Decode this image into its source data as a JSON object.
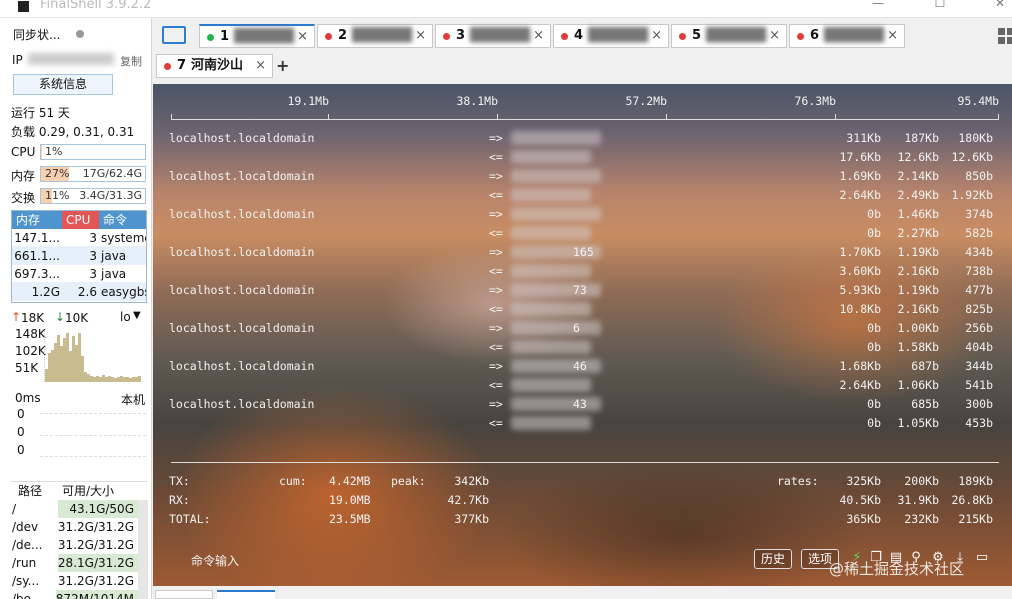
{
  "window": {
    "title": "FinalShell 3.9.2.2",
    "minimize_icon": "—",
    "maximize_icon": "☐",
    "close_icon": "✕"
  },
  "sidebar": {
    "sync_status": "同步状...",
    "ip_label": "IP",
    "copy_label": "复制",
    "sysinfo_button": "系统信息",
    "uptime": "运行 51 天",
    "load": "负载 0.29, 0.31, 0.31",
    "cpu": {
      "label": "CPU",
      "value": "1%",
      "percent": 1
    },
    "mem": {
      "label": "内存",
      "percent_text": "27%",
      "detail": "17G/62.4G",
      "percent": 27
    },
    "swap": {
      "label": "交换",
      "percent_text": "11%",
      "detail": "3.4G/31.3G",
      "percent": 11
    },
    "proc_headers": [
      "内存",
      "CPU",
      "命令"
    ],
    "processes": [
      {
        "mem": "147.1...",
        "cpu": "3",
        "cmd": "systemd"
      },
      {
        "mem": "661.1...",
        "cpu": "3",
        "cmd": "java"
      },
      {
        "mem": "697.3...",
        "cpu": "3",
        "cmd": "java"
      },
      {
        "mem": "1.2G",
        "cpu": "2.6",
        "cmd": "easygbs"
      }
    ],
    "net": {
      "up": "18K",
      "down": "10K",
      "iface": "lo",
      "levels": [
        "148K",
        "102K",
        "51K"
      ]
    },
    "latency": {
      "label": "0ms",
      "host": "本机",
      "values": [
        "0",
        "0",
        "0"
      ]
    },
    "disk_headers": [
      "路径",
      "可用/大小"
    ],
    "disks": [
      {
        "path": "/",
        "size": "43.1G/50G"
      },
      {
        "path": "/dev",
        "size": "31.2G/31.2G"
      },
      {
        "path": "/de...",
        "size": "31.2G/31.2G"
      },
      {
        "path": "/run",
        "size": "28.1G/31.2G"
      },
      {
        "path": "/sy...",
        "size": "31.2G/31.2G"
      },
      {
        "path": "/bo...",
        "size": "872M/1014M"
      }
    ]
  },
  "tabs": [
    {
      "num": "1",
      "name": "██████",
      "status_color": "#22b14c",
      "active": true
    },
    {
      "num": "2",
      "name": "██████",
      "status_color": "#e23b3b",
      "active": false
    },
    {
      "num": "3",
      "name": "██████",
      "status_color": "#e23b3b",
      "active": false
    },
    {
      "num": "4",
      "name": "██████",
      "status_color": "#e23b3b",
      "active": false
    },
    {
      "num": "5",
      "name": "██████",
      "status_color": "#e23b3b",
      "active": false
    },
    {
      "num": "6",
      "name": "██████",
      "status_color": "#e23b3b",
      "active": false
    },
    {
      "num": "7",
      "name": "河南沙山",
      "status_color": "#e23b3b",
      "active": false
    }
  ],
  "tab_close": "×",
  "tab_add": "+",
  "terminal": {
    "scale": [
      "19.1Mb",
      "38.1Mb",
      "57.2Mb",
      "76.3Mb",
      "95.4Mb"
    ],
    "hosts": [
      {
        "host": "localhost.localdomain",
        "peer_suffix": "",
        "tx": [
          "311Kb",
          "187Kb",
          "180Kb"
        ],
        "rx": [
          "17.6Kb",
          "12.6Kb",
          "12.6Kb"
        ]
      },
      {
        "host": "localhost.localdomain",
        "peer_suffix": "",
        "tx": [
          "1.69Kb",
          "2.14Kb",
          "850b"
        ],
        "rx": [
          "2.64Kb",
          "2.49Kb",
          "1.92Kb"
        ]
      },
      {
        "host": "localhost.localdomain",
        "peer_suffix": "",
        "tx": [
          "0b",
          "1.46Kb",
          "374b"
        ],
        "rx": [
          "0b",
          "2.27Kb",
          "582b"
        ]
      },
      {
        "host": "localhost.localdomain",
        "peer_suffix": "165",
        "tx": [
          "1.70Kb",
          "1.19Kb",
          "434b"
        ],
        "rx": [
          "3.60Kb",
          "2.16Kb",
          "738b"
        ]
      },
      {
        "host": "localhost.localdomain",
        "peer_suffix": "73",
        "tx": [
          "5.93Kb",
          "1.19Kb",
          "477b"
        ],
        "rx": [
          "10.8Kb",
          "2.16Kb",
          "825b"
        ]
      },
      {
        "host": "localhost.localdomain",
        "peer_suffix": "6",
        "tx": [
          "0b",
          "1.00Kb",
          "256b"
        ],
        "rx": [
          "0b",
          "1.58Kb",
          "404b"
        ]
      },
      {
        "host": "localhost.localdomain",
        "peer_suffix": "46",
        "tx": [
          "1.68Kb",
          "687b",
          "344b"
        ],
        "rx": [
          "2.64Kb",
          "1.06Kb",
          "541b"
        ]
      },
      {
        "host": "localhost.localdomain",
        "peer_suffix": "43",
        "tx": [
          "0b",
          "685b",
          "300b"
        ],
        "rx": [
          "0b",
          "1.05Kb",
          "453b"
        ]
      }
    ],
    "arrow_out": "=>",
    "arrow_in": "<=",
    "totals": {
      "tx_label": "TX:",
      "rx_label": "RX:",
      "total_label": "TOTAL:",
      "cum_label": "cum:",
      "peak_label": "peak:",
      "rates_label": "rates:",
      "tx_cum": "4.42MB",
      "rx_cum": "19.0MB",
      "total_cum": "23.5MB",
      "tx_peak": "342Kb",
      "rx_peak": "42.7Kb",
      "total_peak": "377Kb",
      "tx_rates": [
        "325Kb",
        "200Kb",
        "189Kb"
      ],
      "rx_rates": [
        "40.5Kb",
        "31.9Kb",
        "26.8Kb"
      ],
      "total_rates": [
        "365Kb",
        "232Kb",
        "215Kb"
      ]
    },
    "cmd_input_label": "命令输入",
    "history_button": "历史",
    "options_button": "选项",
    "watermark": "@稀土掘金技术社区"
  }
}
